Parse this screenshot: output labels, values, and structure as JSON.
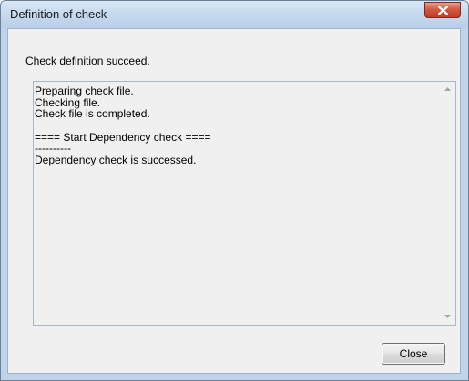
{
  "window": {
    "title": "Definition of check",
    "close_icon": "close-icon"
  },
  "message": "Check definition succeed.",
  "log": {
    "lines": [
      "Preparing check file.",
      "Checking file.",
      "Check file is completed.",
      "",
      "==== Start Dependency check ====",
      "----------",
      "Dependency check is successed."
    ]
  },
  "buttons": {
    "close_label": "Close"
  },
  "colors": {
    "titlebar": "#c4d8ee",
    "close_button_red": "#c23b22",
    "client_background": "#f0f0f0"
  }
}
